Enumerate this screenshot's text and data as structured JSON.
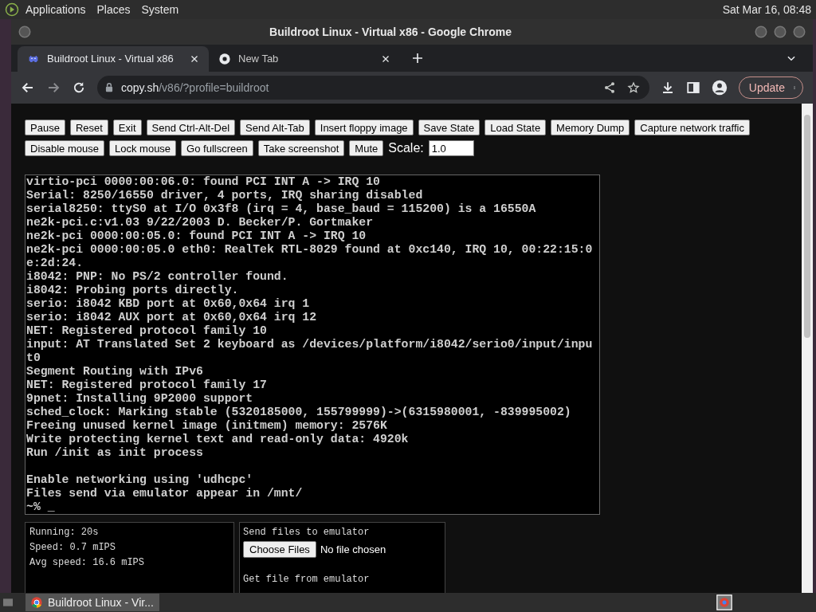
{
  "desktop_panel": {
    "menus": [
      "Applications",
      "Places",
      "System"
    ],
    "clock": "Sat Mar 16, 08:48"
  },
  "browser": {
    "title": "Buildroot Linux - Virtual x86 - Google Chrome",
    "tabs": [
      {
        "label": "Buildroot Linux - Virtual x86",
        "selected": true,
        "kind": "page"
      },
      {
        "label": "New Tab",
        "selected": false,
        "kind": "newtab"
      }
    ],
    "address": {
      "host": "copy.sh",
      "path": "/v86/?profile=buildroot"
    },
    "update_button": "Update"
  },
  "page": {
    "buttons": [
      [
        "Pause",
        "Reset",
        "Exit",
        "Send Ctrl-Alt-Del",
        "Send Alt-Tab",
        "Insert floppy image",
        "Save State",
        "Load State",
        "Memory Dump",
        "Capture network traffic"
      ],
      [
        "Disable mouse",
        "Lock mouse",
        "Go fullscreen",
        "Take screenshot",
        "Mute"
      ]
    ],
    "scale_label": "Scale:",
    "scale_value": "1.0",
    "terminal_blocks": [
      [
        "virtio-pci 0000:00:06.0: found PCI INT A -> IRQ 10",
        "Serial: 8250/16550 driver, 4 ports, IRQ sharing disabled",
        "serial8250: ttyS0 at I/O 0x3f8 (irq = 4, base_baud = 115200) is a 16550A",
        "ne2k-pci.c:v1.03 9/22/2003 D. Becker/P. Gortmaker",
        "ne2k-pci 0000:00:05.0: found PCI INT A -> IRQ 10",
        "ne2k-pci 0000:00:05.0 eth0: RealTek RTL-8029 found at 0xc140, IRQ 10, 00:22:15:0",
        "e:2d:24.",
        "i8042: PNP: No PS/2 controller found.",
        "i8042: Probing ports directly.",
        "serio: i8042 KBD port at 0x60,0x64 irq 1",
        "serio: i8042 AUX port at 0x60,0x64 irq 12",
        "NET: Registered protocol family 10",
        "input: AT Translated Set 2 keyboard as /devices/platform/i8042/serio0/input/inpu",
        "t0",
        "Segment Routing with IPv6",
        "NET: Registered protocol family 17",
        "9pnet: Installing 9P2000 support",
        "sched_clock: Marking stable (5320185000, 155799999)->(6315980001, -839995002)",
        "Freeing unused kernel image (initmem) memory: 2576K",
        "Write protecting kernel text and read-only data: 4920k",
        "Run /init as init process"
      ],
      [
        "Enable networking using 'udhcpc'",
        "Files send via emulator appear in /mnt/",
        "~% _"
      ]
    ],
    "stats": [
      "Running: 20s",
      "Speed: 0.7 mIPS",
      "Avg speed: 16.6 mIPS"
    ],
    "files": {
      "send_label": "Send files to emulator",
      "choose_button": "Choose Files",
      "no_file": "No file chosen",
      "get_label": "Get file from emulator"
    }
  },
  "taskbar": {
    "window_button": "Buildroot Linux - Vir..."
  }
}
